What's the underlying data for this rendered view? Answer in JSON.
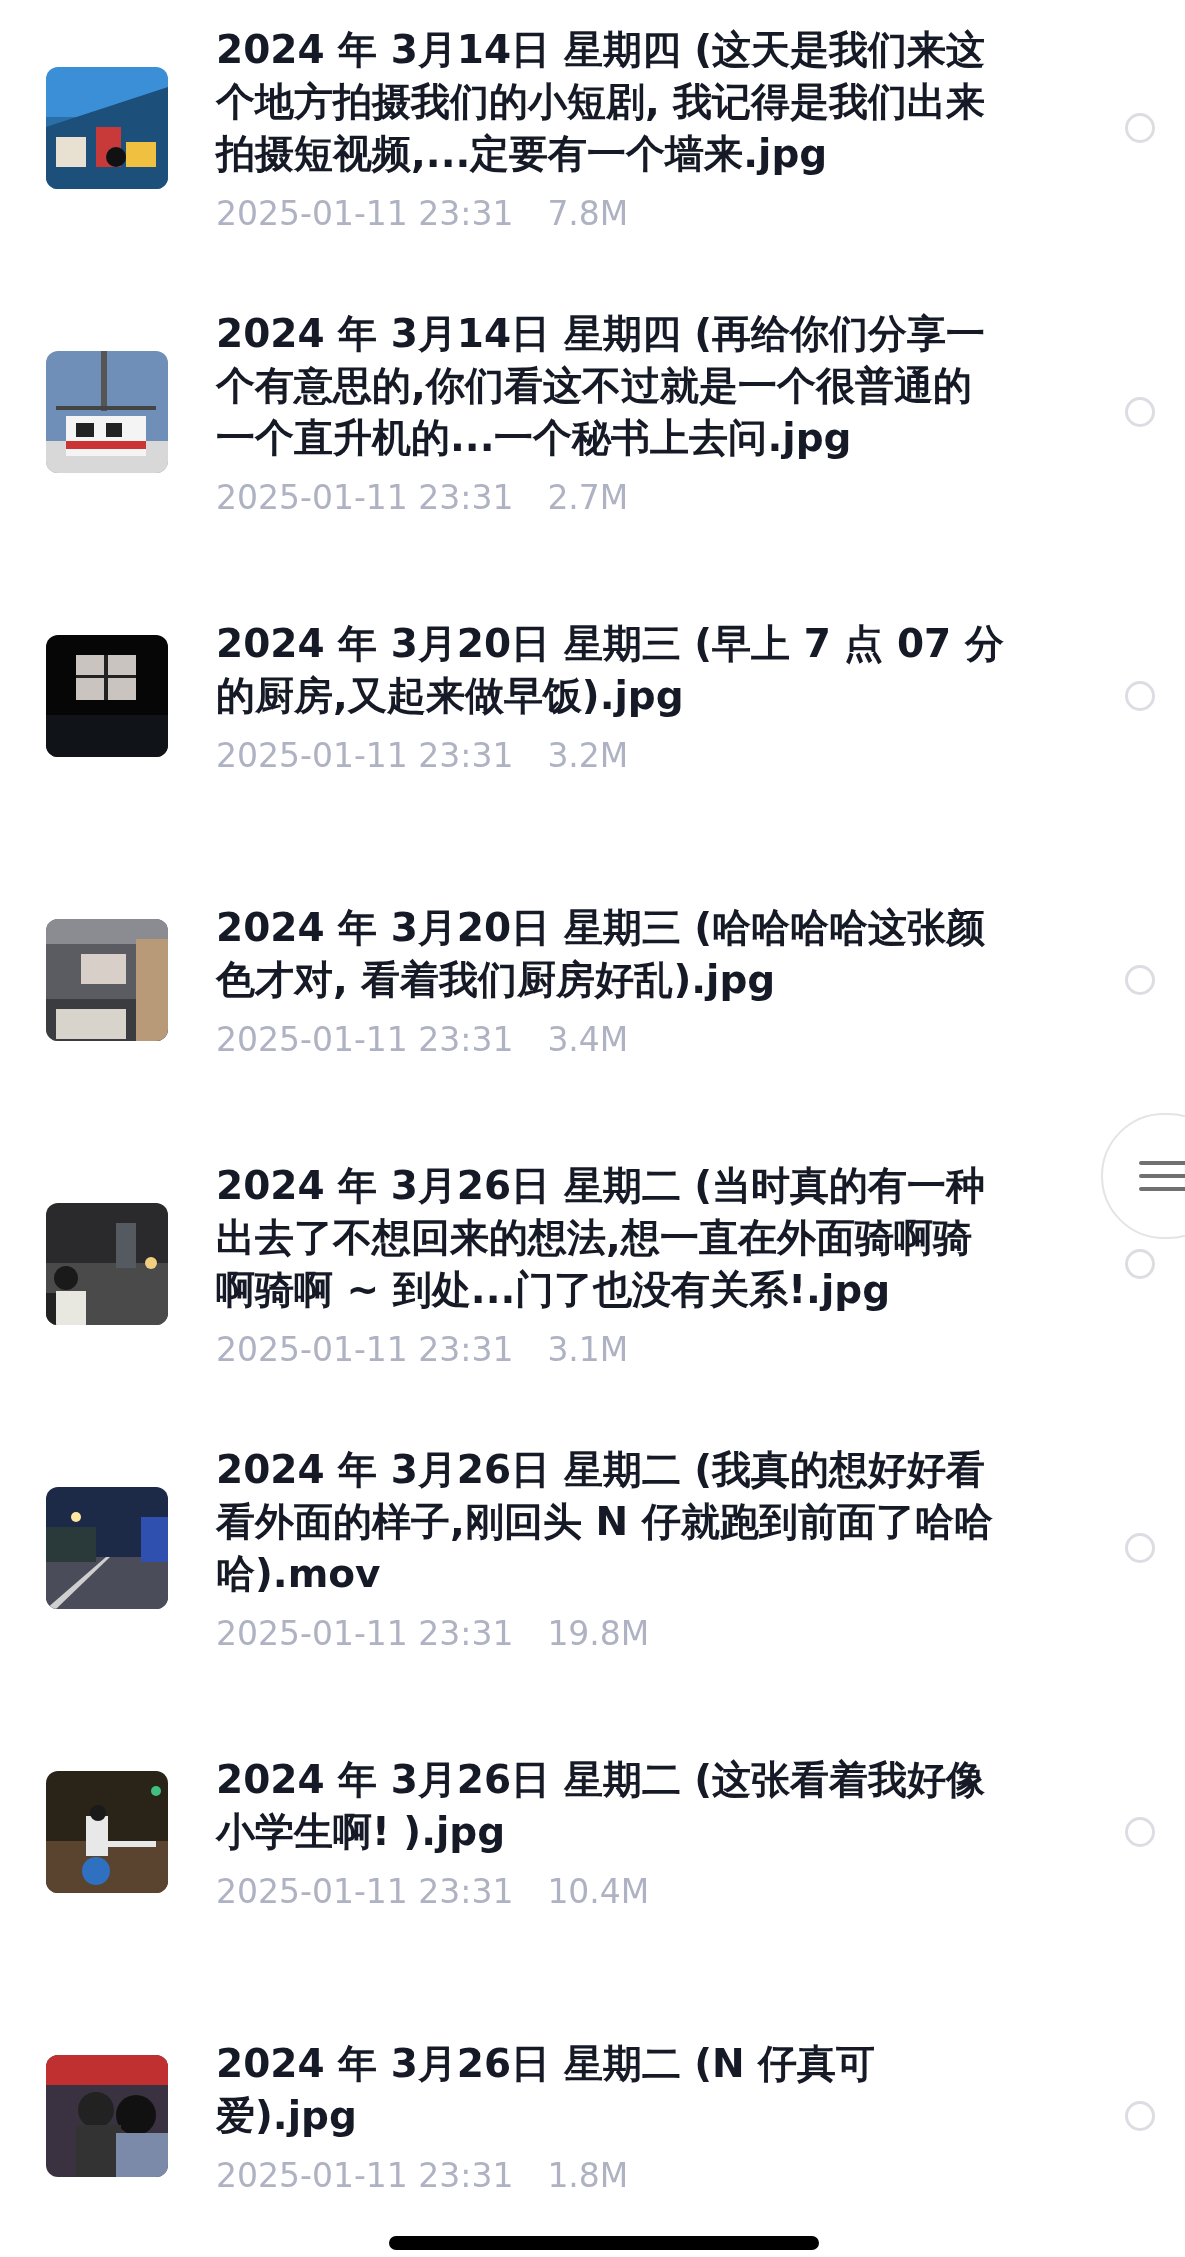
{
  "files": [
    {
      "name": "2024 年 3月14日  星期四 (这天是我们来这个地方拍摄我们的小短剧, 我记得是我们出来拍摄短视频,...定要有一个墙来.jpg",
      "date": "2025-01-11 23:31",
      "size": "7.8M",
      "selected": false
    },
    {
      "name": "2024 年 3月14日  星期四 (再给你们分享一个有意思的,你们看这不过就是一个很普通的一个直升机的...一个秘书上去问.jpg",
      "date": "2025-01-11 23:31",
      "size": "2.7M",
      "selected": false
    },
    {
      "name": "2024 年 3月20日  星期三 (早上 7 点 07 分的厨房,又起来做早饭).jpg",
      "date": "2025-01-11 23:31",
      "size": "3.2M",
      "selected": false
    },
    {
      "name": "2024 年 3月20日  星期三 (哈哈哈哈这张颜色才对, 看着我们厨房好乱).jpg",
      "date": "2025-01-11 23:31",
      "size": "3.4M",
      "selected": false
    },
    {
      "name": "2024 年 3月26日  星期二 (当时真的有一种出去了不想回来的想法,想一直在外面骑啊骑啊骑啊 ~ 到处...门了也没有关系!.jpg",
      "date": "2025-01-11 23:31",
      "size": "3.1M",
      "selected": false
    },
    {
      "name": "2024 年 3月26日  星期二 (我真的想好好看看外面的样子,刚回头 N 仔就跑到前面了哈哈哈).mov",
      "date": "2025-01-11 23:31",
      "size": "19.8M",
      "selected": false
    },
    {
      "name": "2024 年 3月26日  星期二 (这张看着我好像小学生啊! ).jpg",
      "date": "2025-01-11 23:31",
      "size": "10.4M",
      "selected": false
    },
    {
      "name": "2024 年 3月26日  星期二 (N 仔真可爱).jpg",
      "date": "2025-01-11 23:31",
      "size": "1.8M",
      "selected": false
    }
  ]
}
